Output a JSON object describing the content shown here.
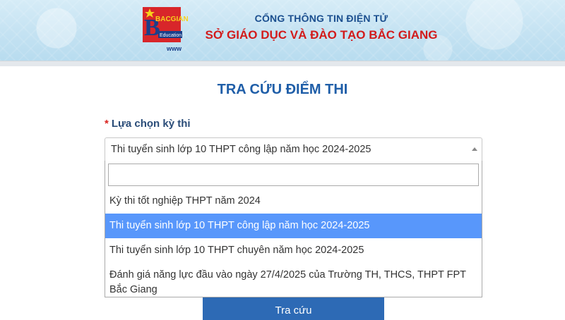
{
  "header": {
    "subtitle": "CỔNG THÔNG TIN ĐIỆN TỬ",
    "title": "SỞ GIÁO DỤC VÀ ĐÀO TẠO BẮC GIANG",
    "logo": {
      "letter": "B",
      "text": "BACGIANG",
      "sub": "Education",
      "www": "www"
    }
  },
  "page": {
    "title": "TRA CỨU ĐIỂM THI"
  },
  "exam_select": {
    "required_mark": "*",
    "label": "Lựa chọn kỳ thi",
    "selected_value": "Thi tuyển sinh lớp 10 THPT công lập năm học 2024-2025",
    "search_value": "",
    "options": [
      "Kỳ thi tốt nghiệp THPT năm 2024",
      "Thi tuyển sinh lớp 10 THPT công lập năm học 2024-2025",
      "Thi tuyển sinh lớp 10 THPT chuyên năm học 2024-2025",
      "Đánh giá năng lực đầu vào ngày 27/4/2025 của Trường TH, THCS, THPT FPT Bắc Giang"
    ],
    "selected_index": 1
  },
  "submit": {
    "label": "Tra cứu"
  },
  "colors": {
    "brand_blue": "#1f5ea8",
    "brand_red": "#d21b1b",
    "highlight": "#5897fb",
    "button": "#2d6ab5"
  }
}
